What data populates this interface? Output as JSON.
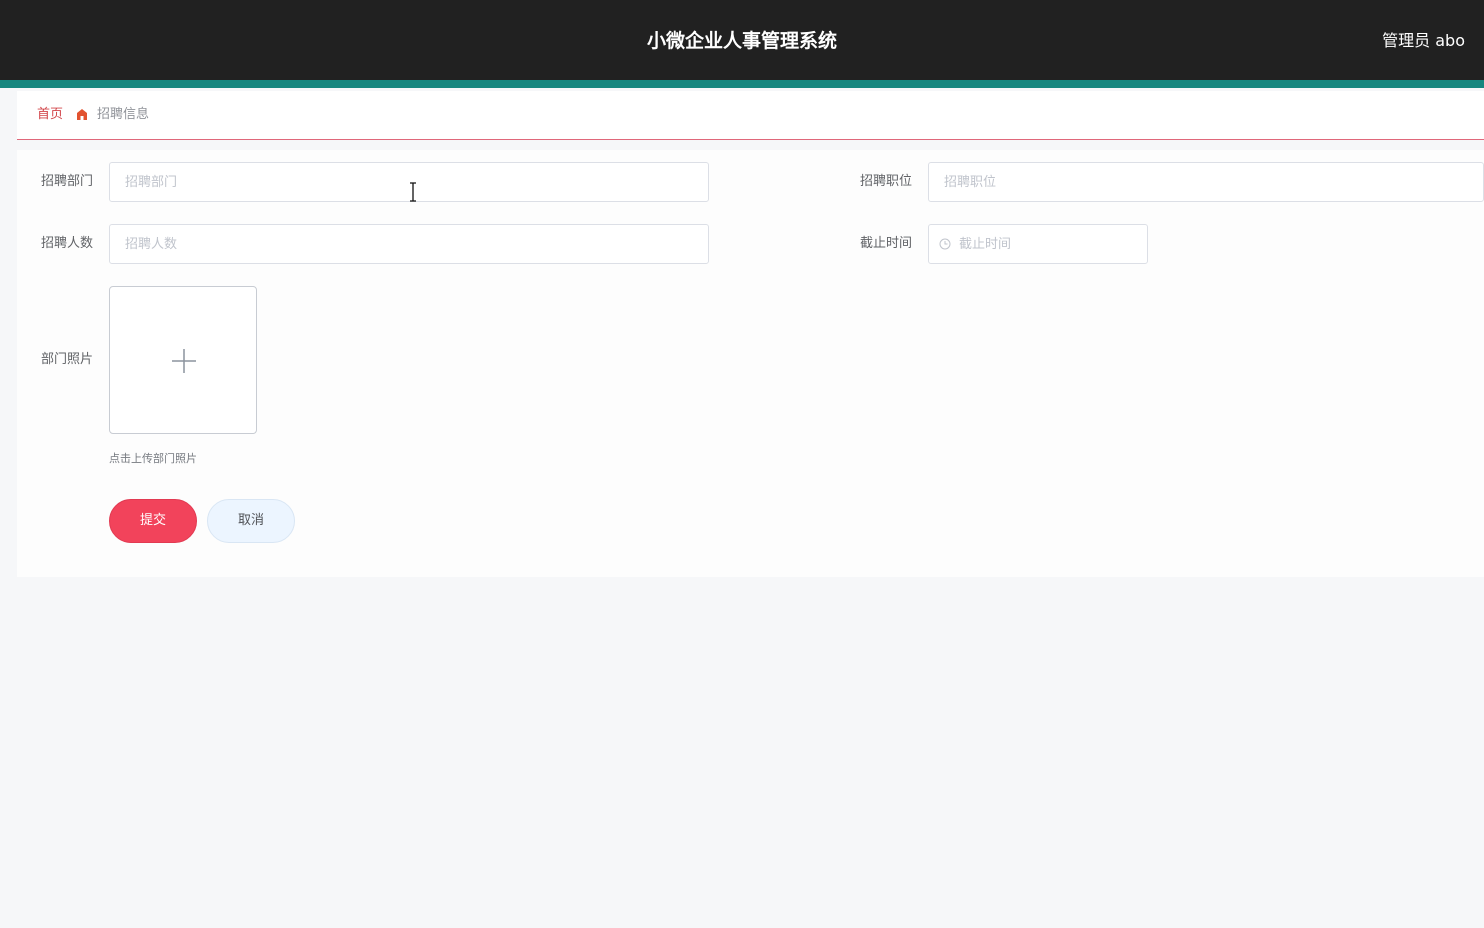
{
  "header": {
    "title": "小微企业人事管理系统",
    "user": "管理员 abo"
  },
  "breadcrumb": {
    "home": "首页",
    "separator_icon": "home-icon",
    "current": "招聘信息"
  },
  "form": {
    "department": {
      "label": "招聘部门",
      "placeholder": "招聘部门",
      "value": ""
    },
    "position": {
      "label": "招聘职位",
      "placeholder": "招聘职位",
      "value": ""
    },
    "headcount": {
      "label": "招聘人数",
      "placeholder": "招聘人数",
      "value": ""
    },
    "deadline": {
      "label": "截止时间",
      "placeholder": "截止时间",
      "value": "",
      "icon": "clock-icon"
    },
    "photo": {
      "label": "部门照片",
      "hint": "点击上传部门照片",
      "icon": "plus-icon"
    }
  },
  "actions": {
    "submit_label": "提交",
    "cancel_label": "取消"
  },
  "colors": {
    "topbar": "#212121",
    "accent_bar": "#17877f",
    "breadcrumb_home": "#d2454a",
    "submit_button": "#f2435b",
    "cancel_button": "#ecf5ff"
  }
}
